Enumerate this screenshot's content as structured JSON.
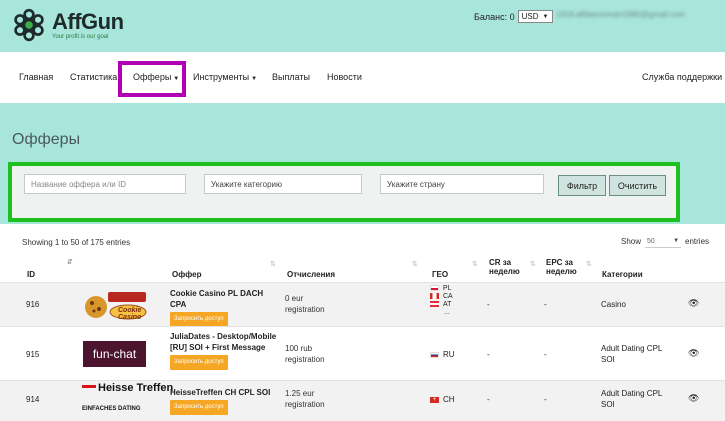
{
  "brand": {
    "name": "AffGun",
    "tagline": "Your profit is our goal"
  },
  "header": {
    "balance_label": "Баланс: 0",
    "currency": "USD",
    "email": "1418.affdanooman1980@gmail.com"
  },
  "nav": {
    "items": [
      "Главная",
      "Статистика",
      "Офферы",
      "Инструменты",
      "Выплаты",
      "Новости"
    ],
    "support": "Служба поддержки"
  },
  "page": {
    "title": "Офферы"
  },
  "filters": {
    "name_placeholder": "Название оффера или ID",
    "category_placeholder": "Укажите категорию",
    "country_placeholder": "Укажите страну",
    "filter_button": "Фильтр",
    "clear_button": "Очистить"
  },
  "table": {
    "showing": "Showing 1 to 50 of 175 entries",
    "show_label": "Show",
    "show_value": "50",
    "entries_label": "entries",
    "headers": {
      "id": "ID",
      "offer": "Оффер",
      "payout": "Отчисления",
      "geo": "ГЕО",
      "cr": "CR за неделю",
      "epc": "EPC за неделю",
      "categories": "Категории"
    },
    "request_label": "Запросить доступ",
    "rows": [
      {
        "id": "916",
        "logo": "Cookie Casino",
        "name": "Cookie Casino PL DACH CPA",
        "payout": "0 eur registration",
        "geo": [
          "PL",
          "CA",
          "AT",
          "..."
        ],
        "cr": "-",
        "epc": "-",
        "category": "Casino"
      },
      {
        "id": "915",
        "logo": "fun-chat",
        "name": "JuliaDates - Desktop/Mobile [RU] SOI + First Message",
        "payout": "100 rub registration",
        "geo": [
          "RU"
        ],
        "cr": "-",
        "epc": "-",
        "category": "Adult Dating CPL SOI"
      },
      {
        "id": "914",
        "logo": "Heisse Treffen",
        "logo_sub": "EINFACHES DATING",
        "name": "HeisseTreffen CH CPL SOI",
        "payout": "1.25 eur registration",
        "geo": [
          "CH"
        ],
        "cr": "-",
        "epc": "-",
        "category": "Adult Dating CPL SOI"
      }
    ]
  },
  "colors": {
    "header_bg": "#a8e6dc",
    "highlight_magenta": "#b300b3",
    "highlight_green": "#1fbf1f",
    "request_btn": "#f5a623"
  }
}
